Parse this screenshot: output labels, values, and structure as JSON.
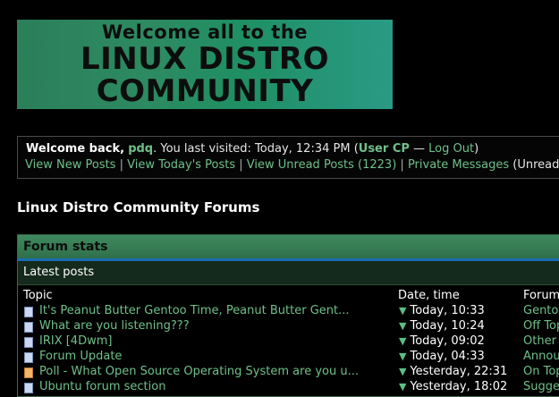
{
  "banner": {
    "line1": "Welcome all to the",
    "line2": "LINUX DISTRO",
    "line3": "COMMUNITY"
  },
  "welcome": {
    "greeting": "Welcome back,",
    "username": "pdq",
    "last_visit": ". You last visited: Today, 12:34 PM (",
    "user_cp": "User CP",
    "dash": " — ",
    "logout": "Log Out",
    "close_paren": ")",
    "links": {
      "new_posts": "View New Posts",
      "todays_posts": "View Today's Posts",
      "unread_posts": "View Unread Posts (1223)",
      "private_messages": "Private Messages",
      "pm_tail": "(Unread"
    },
    "separator": " | "
  },
  "forum_title": "Linux Distro Community Forums",
  "stats": {
    "title": "Forum stats",
    "subtitle": "Latest posts",
    "columns": {
      "topic": "Topic",
      "date": "Date, time",
      "forum": "Forum"
    },
    "rows": [
      {
        "topic": "It's Peanut Butter Gentoo Time, Peanut Butter Gent...",
        "date": "Today, 10:33",
        "forum": "Gento",
        "icon": "normal"
      },
      {
        "topic": "What are you listening???",
        "date": "Today, 10:24",
        "forum": "Off Top",
        "icon": "normal"
      },
      {
        "topic": "IRIX [4Dwm]",
        "date": "Today, 09:02",
        "forum": "Other",
        "icon": "normal"
      },
      {
        "topic": "Forum Update",
        "date": "Today, 04:33",
        "forum": "Annou",
        "icon": "normal"
      },
      {
        "topic": "Poll - What Open Source Operating System are you u...",
        "date": "Yesterday, 22:31",
        "forum": "On Top",
        "icon": "hot"
      },
      {
        "topic": "Ubuntu forum section",
        "date": "Yesterday, 18:02",
        "forum": "Sugge",
        "icon": "normal"
      }
    ]
  },
  "colors": {
    "accent": "#6fc08a",
    "header_green": "#3f8a5e",
    "divider_blue": "#1a6db0"
  }
}
